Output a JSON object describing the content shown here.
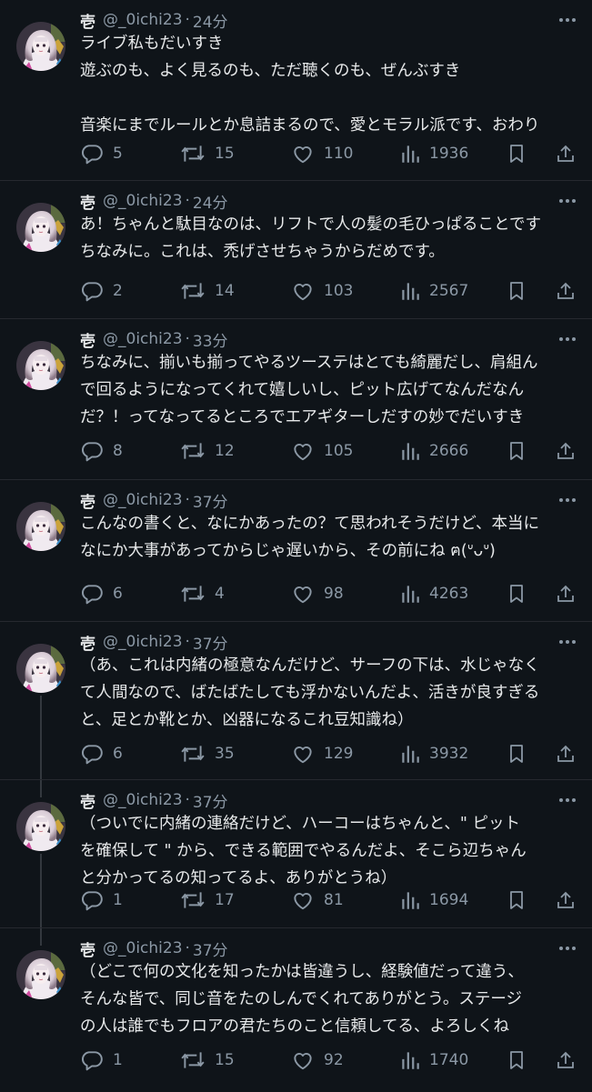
{
  "colors": {
    "background": "#0f1419",
    "text": "#e7e9ea",
    "secondary": "#8b98a5",
    "divider": "#26292f"
  },
  "posts": [
    {
      "name": "壱",
      "handle": "@_0ichi23",
      "time": "24分",
      "lines": [
        "ライブ私もだいすき",
        "遊ぶのも、よく見るのも、ただ聴くのも、ぜんぶすき",
        "",
        "音楽にまでルールとか息詰まるので、愛とモラル派です、おわり"
      ],
      "replies": "5",
      "reposts": "15",
      "likes": "110",
      "views": "1936"
    },
    {
      "name": "壱",
      "handle": "@_0ichi23",
      "time": "24分",
      "lines": [
        "あ！ちゃんと駄目なのは、リフトで人の髪の毛ひっぱることです",
        "ちなみに。これは、禿げさせちゃうからだめです。"
      ],
      "replies": "2",
      "reposts": "14",
      "likes": "103",
      "views": "2567"
    },
    {
      "name": "壱",
      "handle": "@_0ichi23",
      "time": "33分",
      "lines": [
        "ちなみに、揃いも揃ってやるツーステはとても綺麗だし、肩組ん",
        "で回るようになってくれて嬉しいし、ピット広げてなんだなん",
        "だ？！ってなってるところでエアギターしだすの妙でだいすき"
      ],
      "replies": "8",
      "reposts": "12",
      "likes": "105",
      "views": "2666"
    },
    {
      "name": "壱",
      "handle": "@_0ichi23",
      "time": "37分",
      "lines": [
        "こんなの書くと、なにかあったの？て思われそうだけど、本当に",
        "なにか大事があってからじゃ遅いから、その前にね ฅ(ᐡᴗᐡ)"
      ],
      "replies": "6",
      "reposts": "4",
      "likes": "98",
      "views": "4263"
    },
    {
      "name": "壱",
      "handle": "@_0ichi23",
      "time": "37分",
      "lines": [
        "（あ、これは内緒の極意なんだけど、サーフの下は、水じゃなく",
        "て人間なので、ばたばたしても浮かないんだよ、活きが良すぎる",
        "と、足とか靴とか、凶器になるこれ豆知識ね）"
      ],
      "replies": "6",
      "reposts": "35",
      "likes": "129",
      "views": "3932"
    },
    {
      "name": "壱",
      "handle": "@_0ichi23",
      "time": "37分",
      "lines": [
        "（ついでに内緒の連絡だけど、ハーコーはちゃんと、\" ピット",
        "を確保して \" から、できる範囲でやるんだよ、そこら辺ちゃん",
        "と分かってるの知ってるよ、ありがとうね）"
      ],
      "replies": "1",
      "reposts": "17",
      "likes": "81",
      "views": "1694"
    },
    {
      "name": "壱",
      "handle": "@_0ichi23",
      "time": "37分",
      "lines": [
        "（どこで何の文化を知ったかは皆違うし、経験値だって違う、",
        "そんな皆で、同じ音をたのしんでくれてありがとう。ステージ",
        "の人は誰でもフロアの君たちのこと信頼してる、よろしくね"
      ],
      "replies": "1",
      "reposts": "15",
      "likes": "92",
      "views": "1740"
    }
  ]
}
